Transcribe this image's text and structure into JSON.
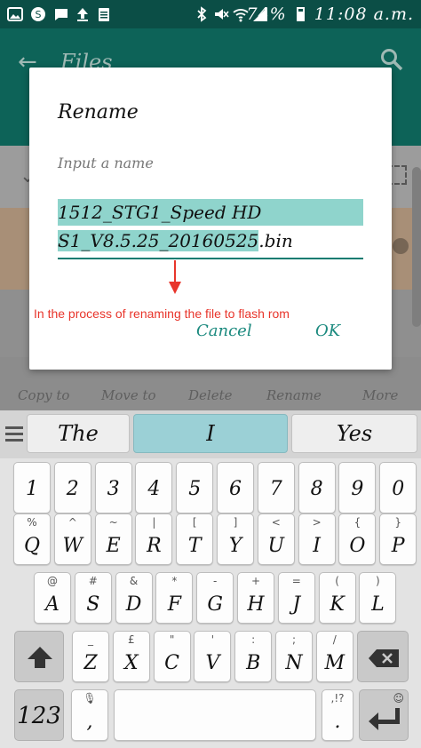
{
  "status_bar": {
    "battery": "74%",
    "time": "11:08 a.m."
  },
  "app_bar": {
    "title": "Files",
    "back_icon": "arrow-left-icon",
    "search_icon": "search-icon"
  },
  "bottom_bar": {
    "items": [
      "Copy to",
      "Move to",
      "Delete",
      "Rename",
      "More"
    ]
  },
  "dialog": {
    "title": "Rename",
    "hint": "Input a name",
    "filename_line1": "1512_STG1_Speed HD",
    "filename_line2_selected": "S1_V8.5.25_20160525",
    "filename_extension": ".bin",
    "cancel_label": "Cancel",
    "ok_label": "OK"
  },
  "annotation": {
    "text": "In the process of renaming the file to flash rom",
    "color": "#e8352b"
  },
  "keyboard": {
    "suggestions": [
      "The",
      "I",
      "Yes"
    ],
    "number_row": [
      "1",
      "2",
      "3",
      "4",
      "5",
      "6",
      "7",
      "8",
      "9",
      "0"
    ],
    "row1": [
      {
        "k": "Q",
        "s": "%"
      },
      {
        "k": "W",
        "s": "^"
      },
      {
        "k": "E",
        "s": "~"
      },
      {
        "k": "R",
        "s": "|"
      },
      {
        "k": "T",
        "s": "["
      },
      {
        "k": "Y",
        "s": "]"
      },
      {
        "k": "U",
        "s": "<"
      },
      {
        "k": "I",
        "s": ">"
      },
      {
        "k": "O",
        "s": "{"
      },
      {
        "k": "P",
        "s": "}"
      }
    ],
    "row2": [
      {
        "k": "A",
        "s": "@"
      },
      {
        "k": "S",
        "s": "#"
      },
      {
        "k": "D",
        "s": "&"
      },
      {
        "k": "F",
        "s": "*"
      },
      {
        "k": "G",
        "s": "-"
      },
      {
        "k": "H",
        "s": "+"
      },
      {
        "k": "J",
        "s": "="
      },
      {
        "k": "K",
        "s": "("
      },
      {
        "k": "L",
        "s": ")"
      }
    ],
    "row3": [
      {
        "k": "Z",
        "s": "_"
      },
      {
        "k": "X",
        "s": "£"
      },
      {
        "k": "C",
        "s": "\""
      },
      {
        "k": "V",
        "s": "'"
      },
      {
        "k": "B",
        "s": ":"
      },
      {
        "k": "N",
        "s": ";"
      },
      {
        "k": "M",
        "s": "/"
      }
    ],
    "symbols_label": "123",
    "comma_label": ",",
    "period_label": ".",
    "punct_hint": ",!?",
    "accent": "#1c8a7f"
  }
}
